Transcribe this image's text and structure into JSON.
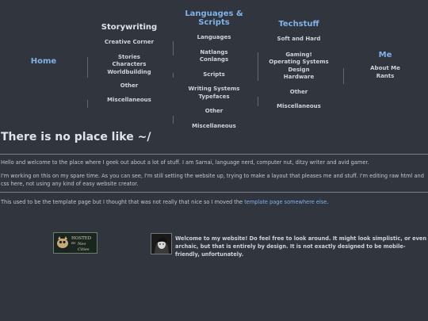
{
  "nav": {
    "home": "Home",
    "storywriting": {
      "title": "Storywriting",
      "items": [
        "Creative Corner",
        "Stories",
        "Characters",
        "Worldbuilding",
        "Other",
        "Miscellaneous"
      ]
    },
    "languages": {
      "title": "Languages & Scripts",
      "items": [
        "Languages",
        "Natlangs",
        "Conlangs",
        "Scripts",
        "Writing Systems",
        "Typefaces",
        "Other",
        "Miscellaneous"
      ]
    },
    "techstuff": {
      "title": "Techstuff",
      "items": [
        "Soft and Hard",
        "Gaming!",
        "Operating Systems",
        "Design",
        "Hardware",
        "Other",
        "Miscellaneous"
      ]
    },
    "me": {
      "title": "Me",
      "items": [
        "About Me",
        "Rants"
      ]
    }
  },
  "page_title": "There is no place like ~/",
  "intro": "Hello and welcome to the place where I geek out about a lot of stuff. I am Sarnai, language nerd, computer nut, ditzy writer and avid gamer.",
  "work": "I'm working on this on my spare time. As you can see, I'm still setting the website up, trying to make a layout that pleases me and stuff. I'm editing raw html and css here, not using any kind of easy website creator.",
  "template": {
    "before": "This used to be the template page but I thought that was not really that nice so I moved the ",
    "link": "template page somewhere else",
    "after": "."
  },
  "badge": {
    "line1": "HOSTED",
    "line2": "BY",
    "line3": "Neo",
    "line4": "Cities"
  },
  "welcome": "Welcome to my website! Do feel free to look around. It might look simplistic, or even archaic, but that is entirely by design. It is not exactly designed to be mobile-friendly, unfortunately.",
  "colors": {
    "background": "#31353d",
    "link": "#7fb2ea",
    "text": "#c9ccd2"
  }
}
